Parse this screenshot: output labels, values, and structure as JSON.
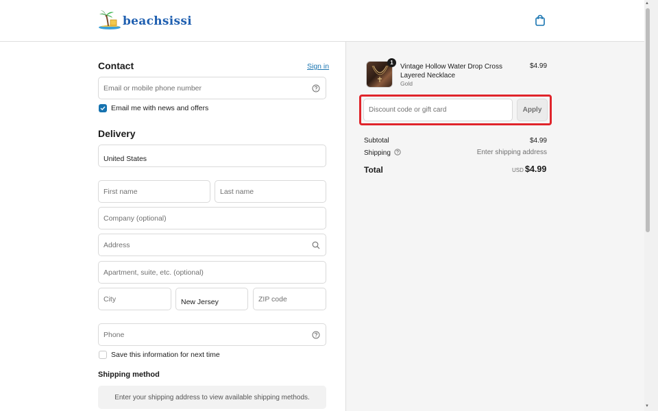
{
  "header": {
    "logo_text": "beachsissi",
    "cart_icon": "shopping-bag-icon"
  },
  "contact": {
    "title": "Contact",
    "sign_in_label": "Sign in",
    "email_placeholder": "Email or mobile phone number",
    "help_icon": "question-circle-icon",
    "email_news_label": "Email me with news and offers",
    "email_news_checked": true
  },
  "delivery": {
    "title": "Delivery",
    "country_value": "United States",
    "first_name_placeholder": "First name",
    "last_name_placeholder": "Last name",
    "company_placeholder": "Company (optional)",
    "address_placeholder": "Address",
    "apartment_placeholder": "Apartment, suite, etc. (optional)",
    "city_placeholder": "City",
    "state_value": "New Jersey",
    "zip_placeholder": "ZIP code",
    "phone_placeholder": "Phone",
    "save_info_label": "Save this information for next time",
    "save_info_checked": false
  },
  "shipping_method": {
    "title": "Shipping method",
    "notice": "Enter your shipping address to view available shipping methods."
  },
  "order_summary": {
    "item": {
      "quantity": "1",
      "name": "Vintage Hollow Water Drop Cross Layered Necklace",
      "variant": "Gold",
      "price": "$4.99"
    },
    "discount_placeholder": "Discount code or gift card",
    "apply_label": "Apply",
    "subtotal_label": "Subtotal",
    "subtotal_value": "$4.99",
    "shipping_label": "Shipping",
    "shipping_value": "Enter shipping address",
    "total_label": "Total",
    "total_currency": "USD",
    "total_value": "$4.99"
  },
  "colors": {
    "accent": "#1773b0",
    "highlight": "#e0242b"
  }
}
